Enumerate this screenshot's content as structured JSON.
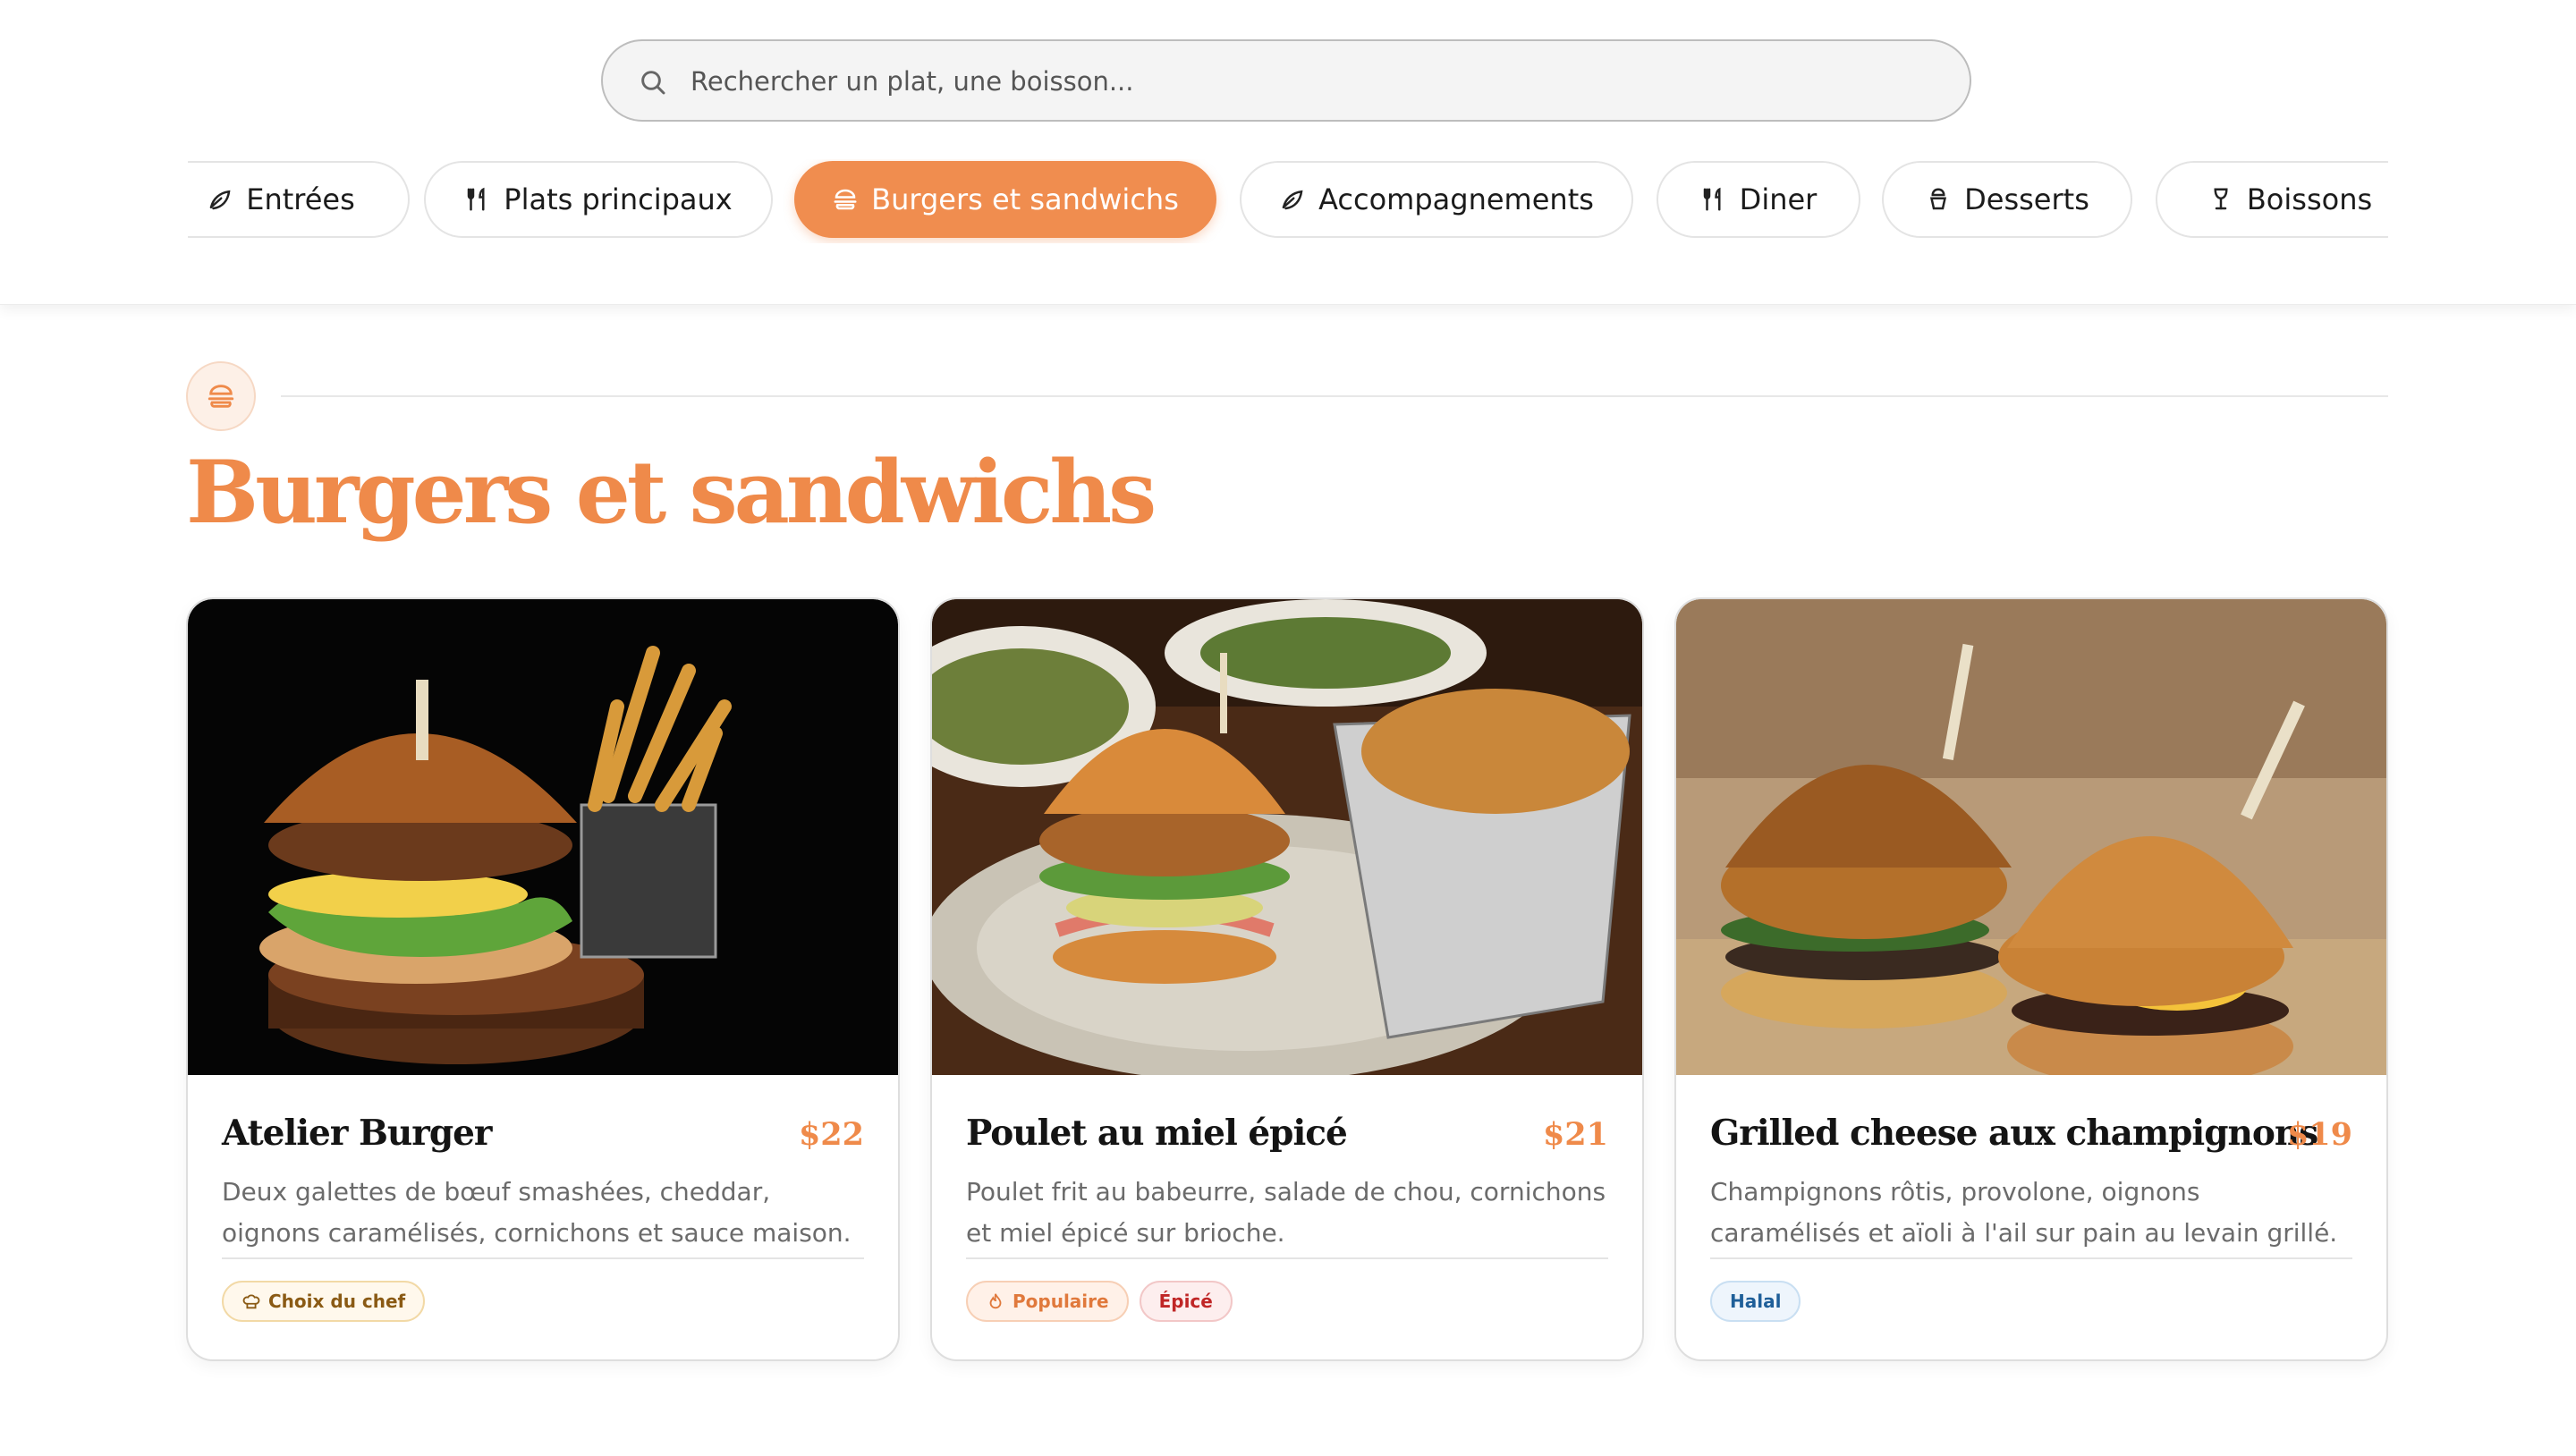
{
  "search": {
    "placeholder": "Rechercher un plat, une boisson..."
  },
  "categories": [
    {
      "label": "Entrées",
      "icon": "leaf-icon",
      "active": false
    },
    {
      "label": "Plats principaux",
      "icon": "utensils-icon",
      "active": false
    },
    {
      "label": "Burgers et sandwichs",
      "icon": "burger-icon",
      "active": true
    },
    {
      "label": "Accompagnements",
      "icon": "leaf-icon",
      "active": false
    },
    {
      "label": "Diner",
      "icon": "utensils-icon",
      "active": false
    },
    {
      "label": "Desserts",
      "icon": "cupcake-icon",
      "active": false
    },
    {
      "label": "Boissons",
      "icon": "wine-glass-icon",
      "active": false
    }
  ],
  "section": {
    "title": "Burgers et sandwichs",
    "icon": "burger-icon"
  },
  "items": [
    {
      "name": "Atelier Burger",
      "price": "$22",
      "description": "Deux galettes de bœuf smashées, cheddar, oignons caramélisés, cornichons et sauce maison.",
      "image": "burger-with-fries-dark-background",
      "tags": [
        {
          "label": "Choix du chef",
          "icon": "chef-hat-icon"
        }
      ]
    },
    {
      "name": "Poulet au miel épicé",
      "price": "$21",
      "description": "Poulet frit au babeurre, salade de chou, cornichons et miel épicé sur brioche.",
      "image": "chicken-burger-plate-with-chips",
      "tags": [
        {
          "label": "Populaire",
          "icon": "flame-icon"
        },
        {
          "label": "Épicé",
          "icon": ""
        }
      ]
    },
    {
      "name": "Grilled cheese aux champignons",
      "price": "$19",
      "description": "Champignons rôtis, provolone, oignons caramélisés et aïoli à l'ail sur pain au levain grillé.",
      "image": "two-mini-burgers-on-wood",
      "tags": [
        {
          "label": "Halal",
          "icon": ""
        }
      ]
    }
  ],
  "colors": {
    "accent": "#ef8a4a",
    "active_chip": "#f08d4f",
    "text": "#1a1a1a",
    "muted": "#6b6b6b"
  }
}
